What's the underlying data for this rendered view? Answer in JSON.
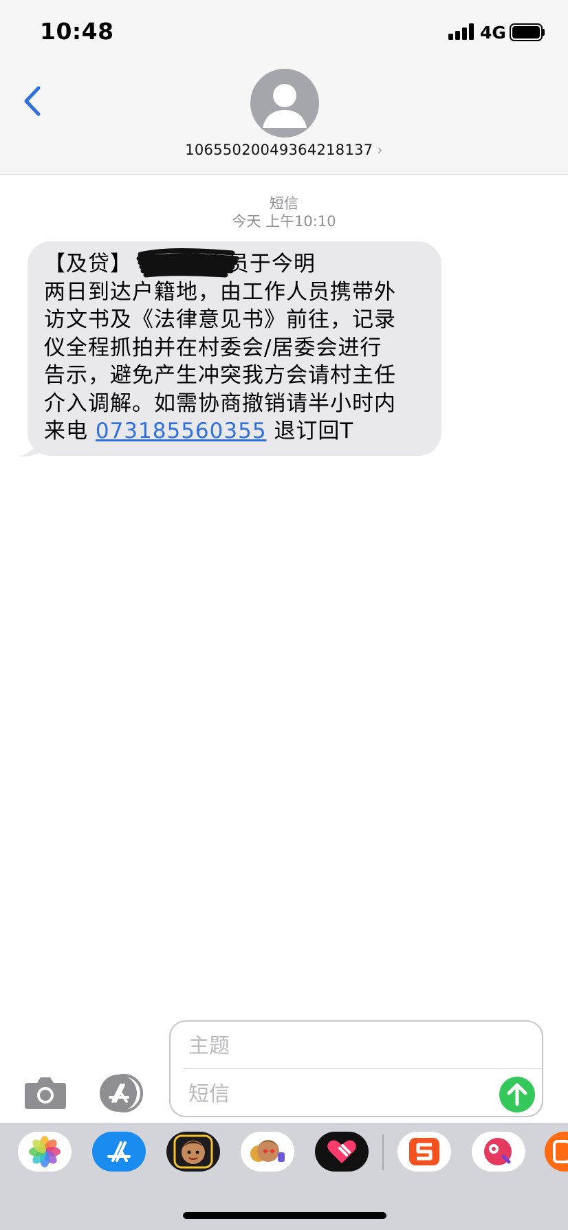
{
  "status_bar": {
    "time": "10:48",
    "network": "4G"
  },
  "header": {
    "contact_number": "10655020049364218137",
    "contact_chevron": "›",
    "back_icon": "chevron-left-icon",
    "avatar_icon": "person-silhouette-icon"
  },
  "conversation": {
    "service_label": "短信",
    "timestamp": "今天 上午10:10",
    "message": {
      "lines": [
        "【及贷】        地工作人员于今明",
        "两日到达户籍地，由工作人员携带外",
        "访文书及《法律意见书》前往，记录",
        "仪全程抓拍并在村委会/居委会进行",
        "告示，避免产生冲突我方会请村主任",
        "介入调解。如需协商撤销请半小时内"
      ],
      "last_prefix": "来电 ",
      "phone_link": "073185560355",
      "last_suffix": " 退订回T"
    }
  },
  "compose": {
    "subject_placeholder": "主题",
    "message_placeholder": "短信",
    "send_icon": "arrow-up-icon",
    "camera_icon": "camera-icon",
    "apps_icon": "app-store-icon"
  },
  "app_tray": {
    "apps": [
      "photos-icon",
      "app-store-icon",
      "memoji-icon",
      "animoji-stickers-icon",
      "digital-touch-icon",
      "sogou-keyboard-icon",
      "music-app-icon",
      "partial-app-icon"
    ]
  },
  "colors": {
    "accent_blue": "#2f6fe0",
    "send_green": "#34c759",
    "bubble_gray": "#e9e9eb"
  }
}
